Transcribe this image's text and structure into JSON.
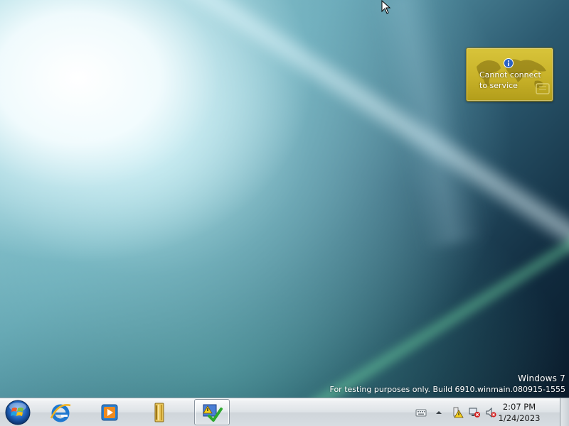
{
  "gadget": {
    "message": "Cannot connect\nto service",
    "icon": "info-icon"
  },
  "watermark": {
    "title": "Windows  7",
    "build": "For testing purposes only. Build 6910.winmain.080915-1555"
  },
  "taskbar": {
    "start_icon": "windows-start-orb-icon",
    "pinned": [
      {
        "name": "internet-explorer",
        "icon": "internet-explorer-icon"
      },
      {
        "name": "media-player",
        "icon": "media-player-icon"
      },
      {
        "name": "file-explorer",
        "icon": "libraries-folder-icon"
      },
      {
        "name": "action-center-window",
        "icon": "action-center-flag-icon",
        "active": true
      }
    ],
    "tray": {
      "icons": [
        "keyboard-icon",
        "show-hidden-icons-chevron-icon",
        "action-center-warning-icon",
        "network-error-icon",
        "volume-muted-icon"
      ],
      "time": "2:07 PM",
      "date": "1/24/2023"
    }
  },
  "colors": {
    "gadget_bg": "#c8b229",
    "taskbar_bg": "#dde2e6",
    "watermark_text": "#ffffff"
  }
}
